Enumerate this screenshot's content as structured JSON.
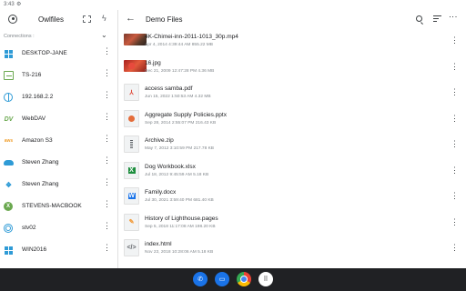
{
  "status": {
    "time": "3:43"
  },
  "sidebar": {
    "title": "Owlfiles",
    "connections_label": "Connections :",
    "items": [
      {
        "label": "DESKTOP-JANE",
        "icon": "windows-icon"
      },
      {
        "label": "TS-216",
        "icon": "nas-server-icon"
      },
      {
        "label": "192.168.2.2",
        "icon": "globe-icon"
      },
      {
        "label": "WebDAV",
        "icon": "webdav-icon"
      },
      {
        "label": "Amazon S3",
        "icon": "aws-icon"
      },
      {
        "label": "Steven Zhang",
        "icon": "onedrive-cloud-icon"
      },
      {
        "label": "Steven Zhang",
        "icon": "dropbox-icon"
      },
      {
        "label": "STEVENS-MACBOOK",
        "icon": "x-circle-icon"
      },
      {
        "label": "stv02",
        "icon": "ring-icon"
      },
      {
        "label": "WIN2016",
        "icon": "windows-icon"
      }
    ]
  },
  "main": {
    "title": "Demo Files",
    "files": [
      {
        "name": "4K-Chimei-inn-2011-1013_30p.mp4",
        "meta": "Apr 4, 2014 4:39:44 AM    855.22 MB",
        "type": "video"
      },
      {
        "name": "16.jpg",
        "meta": "Dec 21, 2009 12:47:28 PM    4.36 MB",
        "type": "image"
      },
      {
        "name": "access samba.pdf",
        "meta": "Jun 15, 2022 1:50:53 AM    4.32 MB",
        "type": "pdf"
      },
      {
        "name": "Aggregate Supply Policies.pptx",
        "meta": "Sep 28, 2014 2:55:07 PM    216.43 KB",
        "type": "pptx"
      },
      {
        "name": "Archive.zip",
        "meta": "May 7, 2012 3:10:59 PM    217.78 KB",
        "type": "zip"
      },
      {
        "name": "Dog Workbook.xlsx",
        "meta": "Jul 18, 2012 9:45:59 AM    5.18 KB",
        "type": "xlsx"
      },
      {
        "name": "Family.docx",
        "meta": "Jul 30, 2021 3:59:40 PM    681.40 KB",
        "type": "docx"
      },
      {
        "name": "History of Lighthouse.pages",
        "meta": "Sep 5, 2018 11:17:08 AM    198.20 KB",
        "type": "pages"
      },
      {
        "name": "index.html",
        "meta": "Nov 23, 2018 10:28:06 AM    5.18 KB",
        "type": "html"
      }
    ]
  },
  "dock": [
    "phone-icon",
    "messages-icon",
    "chrome-icon",
    "app-drawer-icon"
  ]
}
